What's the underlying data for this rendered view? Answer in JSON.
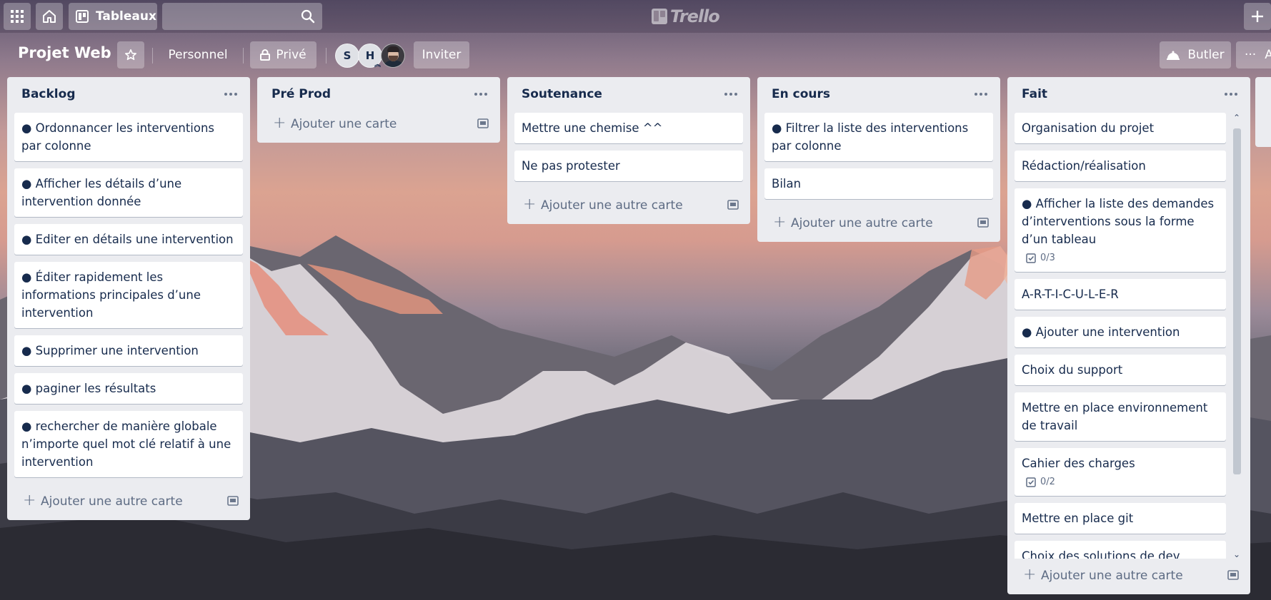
{
  "header": {
    "boards_label": "Tableaux",
    "logo_text": "Trello",
    "search_placeholder": ""
  },
  "board": {
    "title": "Projet Web",
    "team_label": "Personnel",
    "visibility_label": "Privé",
    "members": [
      "S",
      "H"
    ],
    "invite_label": "Inviter",
    "butler_label": "Butler",
    "more_label": "A"
  },
  "lists": [
    {
      "title": "Backlog",
      "cards": [
        {
          "text": "● Ordonnancer les interventions par colonne"
        },
        {
          "text": "● Afficher les détails d’une intervention donnée"
        },
        {
          "text": "● Editer en détails une intervention"
        },
        {
          "text": "● Éditer rapidement les informations principales d’une intervention"
        },
        {
          "text": "● Supprimer une intervention"
        },
        {
          "text": "● paginer les résultats"
        },
        {
          "text": "● rechercher de manière globale n’importe quel mot clé relatif à une intervention"
        }
      ],
      "add_label": "Ajouter une autre carte"
    },
    {
      "title": "Pré Prod",
      "cards": [],
      "add_label": "Ajouter une carte"
    },
    {
      "title": "Soutenance",
      "cards": [
        {
          "text": "Mettre une chemise ^^"
        },
        {
          "text": "Ne pas protester"
        }
      ],
      "add_label": "Ajouter une autre carte"
    },
    {
      "title": "En cours",
      "cards": [
        {
          "text": "● Filtrer la liste des interventions par colonne"
        },
        {
          "text": "Bilan"
        }
      ],
      "add_label": "Ajouter une autre carte"
    },
    {
      "title": "Fait",
      "cards": [
        {
          "text": "Organisation du projet"
        },
        {
          "text": "Rédaction/réalisation"
        },
        {
          "text": "● Afficher la liste des demandes d’interventions sous la forme d’un tableau",
          "checklist": "0/3"
        },
        {
          "text": "A-R-T-I-C-U-L-E-R"
        },
        {
          "text": "● Ajouter une intervention"
        },
        {
          "text": "Choix du support"
        },
        {
          "text": "Mettre en place environnement de travail"
        },
        {
          "text": "Cahier des charges",
          "checklist": "0/2"
        },
        {
          "text": "Mettre en place git"
        },
        {
          "text": "Choix des solutions de dev"
        }
      ],
      "add_label": "Ajouter une autre carte"
    }
  ]
}
